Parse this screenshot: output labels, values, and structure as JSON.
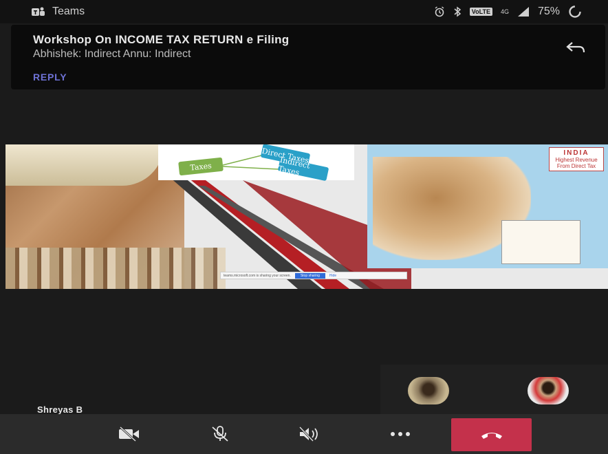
{
  "status_bar": {
    "app_name": "Teams",
    "network_badge": "VoLTE",
    "network_signal": "4G",
    "battery": "75%",
    "icons": [
      "teams-icon",
      "alarm-icon",
      "bluetooth-icon",
      "signal-icon",
      "battery-icon"
    ]
  },
  "notification": {
    "title": "Workshop On INCOME TAX RETURN e Filing",
    "body": "Abhishek: Indirect Annu: Indirect",
    "reply_label": "REPLY"
  },
  "shared_screen": {
    "diagram": {
      "root": "Taxes",
      "branch_direct": "Direct Taxes",
      "branch_indirect": "Indirect Taxes"
    },
    "map": {
      "title": "INDIA",
      "subtitle": "Highest Revenue From Direct Tax"
    },
    "share_notice": {
      "message": "teams.microsoft.com is sharing your screen.",
      "stop_label": "Stop sharing",
      "hide_label": "Hide"
    }
  },
  "call": {
    "speaker_name": "Shreyas B"
  },
  "colors": {
    "hangup": "#c4314b",
    "reply": "#6e72d6",
    "background": "#1b1b1b"
  }
}
